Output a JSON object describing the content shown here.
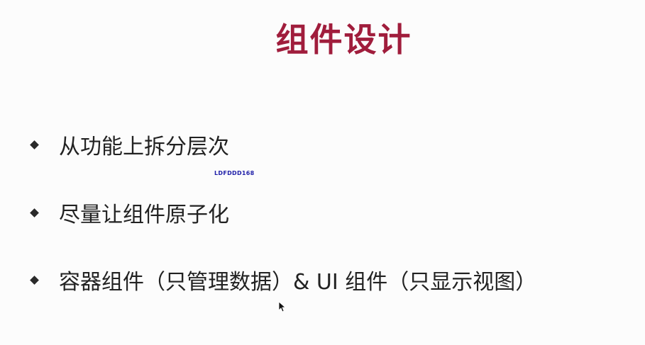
{
  "slide": {
    "title": "组件设计",
    "bullets": [
      "从功能上拆分层次",
      "尽量让组件原子化",
      "容器组件（只管理数据）& UI 组件（只显示视图）"
    ],
    "watermark": "LDFDDD168"
  },
  "colors": {
    "title": "#a01d3c",
    "text": "#222222",
    "watermark": "#1e1ea8",
    "background": "#fcfcfc"
  },
  "icons": {
    "bullet": "diamond-bullet-icon",
    "cursor": "mouse-pointer-icon"
  }
}
